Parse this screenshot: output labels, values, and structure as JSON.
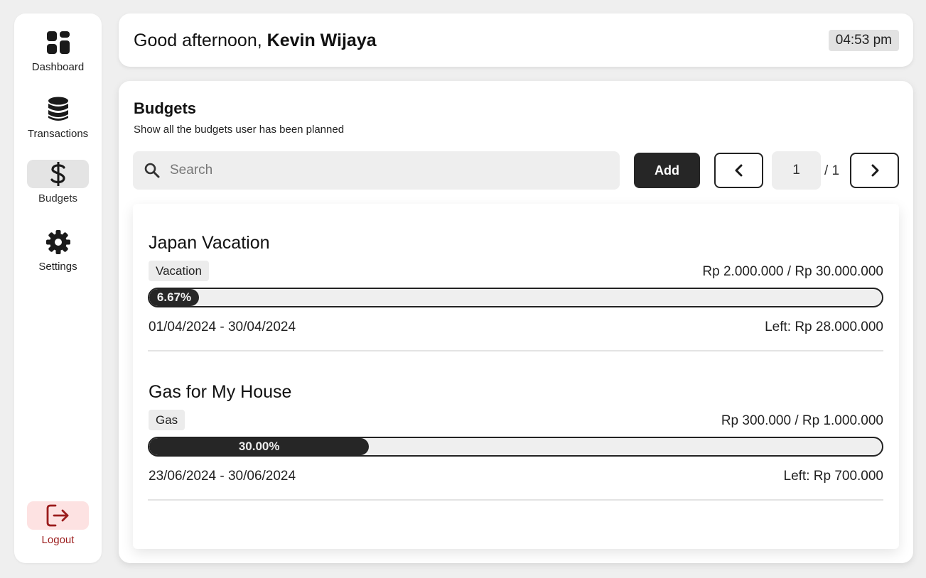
{
  "sidebar": {
    "items": [
      {
        "label": "Dashboard",
        "icon": "dashboard-icon"
      },
      {
        "label": "Transactions",
        "icon": "database-icon"
      },
      {
        "label": "Budgets",
        "icon": "dollar-icon",
        "active": true
      },
      {
        "label": "Settings",
        "icon": "gear-icon"
      }
    ],
    "logout": {
      "label": "Logout",
      "icon": "logout-icon",
      "color": "#9b1c1c"
    }
  },
  "header": {
    "greeting": "Good afternoon, ",
    "user_name": "Kevin Wijaya",
    "time": "04:53 pm"
  },
  "budgets_page": {
    "title": "Budgets",
    "subtitle": "Show all the budgets user has been planned",
    "search": {
      "placeholder": "Search",
      "value": ""
    },
    "add_label": "Add",
    "pagination": {
      "current": "1",
      "total": "/ 1"
    },
    "items": [
      {
        "name": "Japan Vacation",
        "category": "Vacation",
        "amount": "Rp 2.000.000 / Rp 30.000.000",
        "progress_label": "6.67%",
        "progress_fraction": 0.0667,
        "dates": "01/04/2024 - 30/04/2024",
        "left": "Left: Rp 28.000.000"
      },
      {
        "name": "Gas for My House",
        "category": "Gas",
        "amount": "Rp 300.000 / Rp 1.000.000",
        "progress_label": "30.00%",
        "progress_fraction": 0.3,
        "dates": "23/06/2024 - 30/06/2024",
        "left": "Left: Rp 700.000"
      }
    ]
  },
  "colors": {
    "accent_dark": "#262626",
    "background": "#efefef",
    "logout_bg": "#fde2e2",
    "logout_fg": "#9b1c1c"
  }
}
